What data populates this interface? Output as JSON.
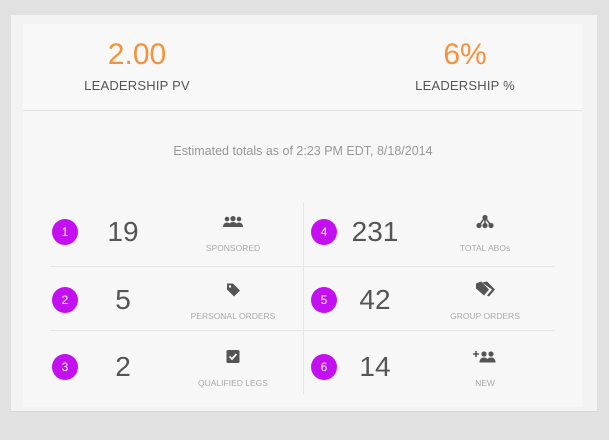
{
  "summary": {
    "leadership_pv": {
      "value": "2.00",
      "label": "LEADERSHIP PV"
    },
    "leadership_pct": {
      "value": "6%",
      "label": "LEADERSHIP %"
    }
  },
  "estimate_text": "Estimated totals as of 2:23 PM EDT, 8/18/2014",
  "stats": [
    {
      "badge": "1",
      "value": "19",
      "label": "SPONSORED",
      "icon": "people-group-icon"
    },
    {
      "badge": "2",
      "value": "5",
      "label": "PERSONAL ORDERS",
      "icon": "tag-icon"
    },
    {
      "badge": "3",
      "value": "2",
      "label": "QUALIFIED LEGS",
      "icon": "checkbox-icon"
    },
    {
      "badge": "4",
      "value": "231",
      "label": "TOTAL ABOs",
      "icon": "network-icon"
    },
    {
      "badge": "5",
      "value": "42",
      "label": "GROUP ORDERS",
      "icon": "tags-icon"
    },
    {
      "badge": "6",
      "value": "14",
      "label": "NEW",
      "icon": "add-people-icon"
    }
  ],
  "colors": {
    "accent": "#f7923a",
    "badge": "#c40ff0",
    "text": "#555555"
  }
}
